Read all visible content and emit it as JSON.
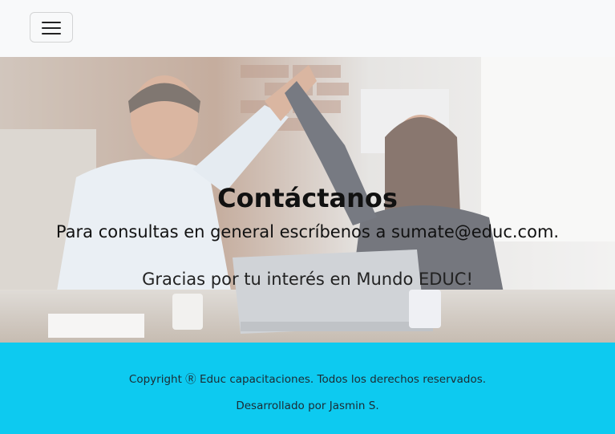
{
  "navbar": {
    "toggle_icon": "hamburger-icon"
  },
  "hero": {
    "title": "Contáctanos",
    "contact_line": "Para consultas en general escríbenos a sumate@educ.com.",
    "thanks_line": "Gracias por tu interés en Mundo EDUC!"
  },
  "footer": {
    "copyright": "Copyright Ⓡ Educ capacitaciones. Todos los derechos reservados.",
    "developer": "Desarrollado por Jasmin S.",
    "background_color": "#0dcaf0"
  }
}
